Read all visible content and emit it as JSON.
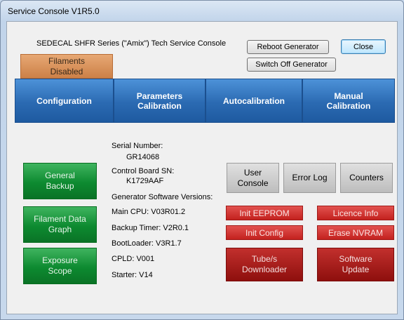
{
  "window": {
    "title": "Service Console V1R5.0"
  },
  "header": {
    "heading": "SEDECAL SHFR Series (\"Amix\") Tech Service Console",
    "reboot_label": "Reboot Generator",
    "close_label": "Close",
    "switch_off_label": "Switch Off Generator",
    "filaments_status": "Filaments\nDisabled"
  },
  "tabs": [
    {
      "label": "Configuration"
    },
    {
      "label": "Parameters\nCalibration"
    },
    {
      "label": "Autocalibration"
    },
    {
      "label": "Manual\nCalibration"
    }
  ],
  "info": {
    "serial_label": "Serial Number:",
    "serial_value": "GR14068",
    "board_label": "Control Board SN:",
    "board_value": "K1729AAF",
    "versions_label": "Generator Software Versions:",
    "main_cpu": "Main CPU: V03R01.2",
    "backup_timer": "Backup Timer: V2R0.1",
    "bootloader": "BootLoader: V3R1.7",
    "cpld": "CPLD: V001",
    "starter": "Starter: V14"
  },
  "green_buttons": [
    {
      "label": "General\nBackup"
    },
    {
      "label": "Filament Data\nGraph"
    },
    {
      "label": "Exposure\nScope"
    }
  ],
  "grey_buttons": [
    {
      "label": "User\nConsole"
    },
    {
      "label": "Error Log"
    },
    {
      "label": "Counters"
    }
  ],
  "red_buttons": {
    "init_eeprom": "Init EEPROM",
    "licence_info": "Licence Info",
    "init_config": "Init Config",
    "erase_nvram": "Erase NVRAM",
    "tube_downloader": "Tube/s\nDownloader",
    "software_update": "Software\nUpdate"
  },
  "colors": {
    "tab_blue": "#2b6ab2",
    "green": "#0d8a30",
    "red_light": "#c3211e",
    "red_dark": "#8e0f0d",
    "filaments_orange": "#d98c52"
  }
}
